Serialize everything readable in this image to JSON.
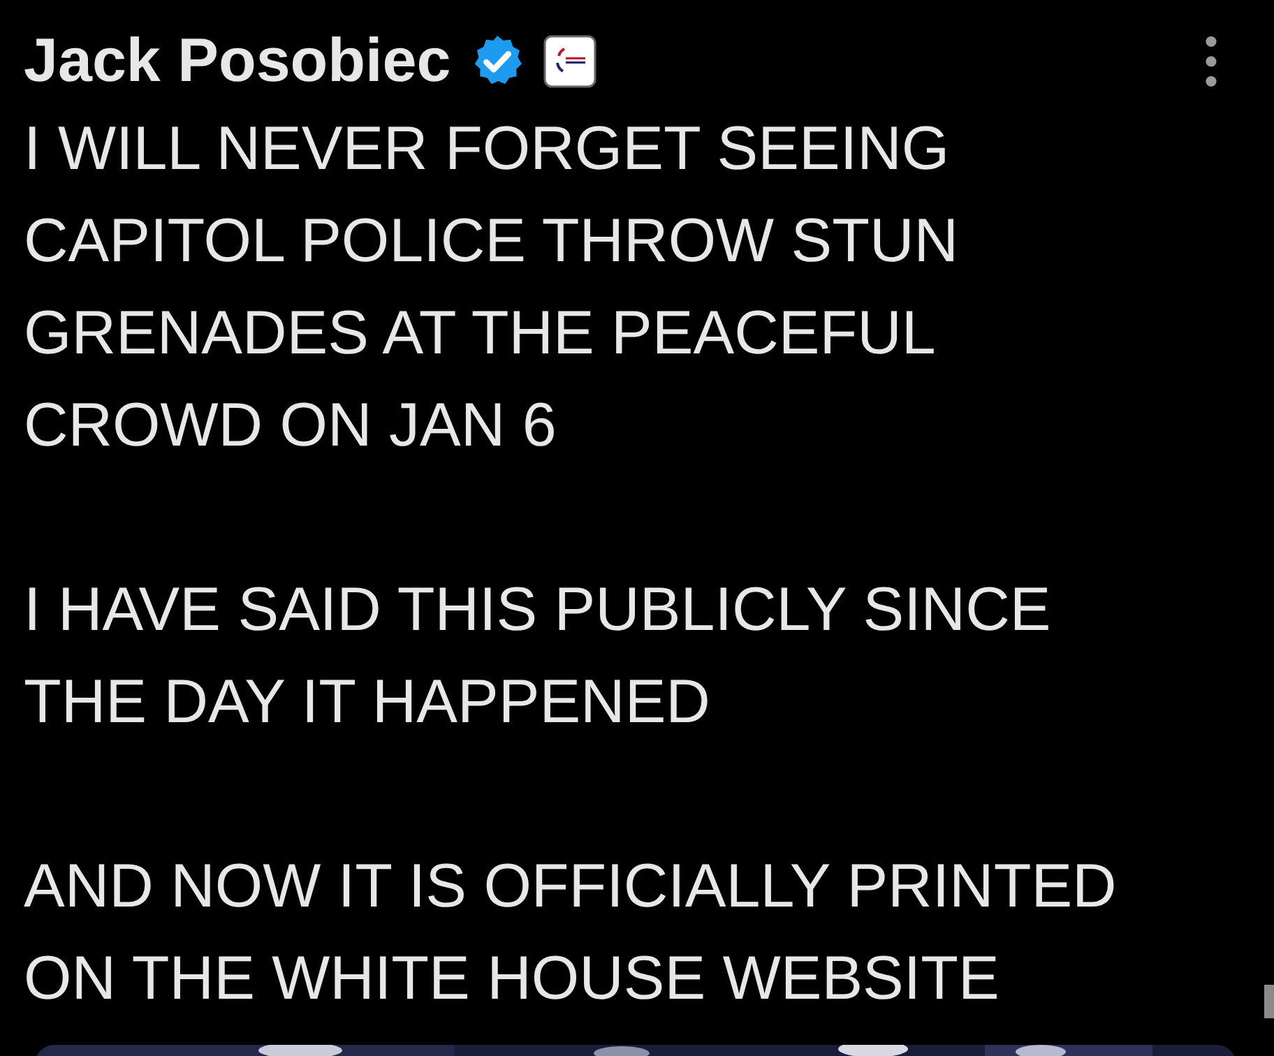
{
  "post": {
    "author": "Jack Posobiec",
    "verified": true,
    "paragraphs": [
      "I WILL NEVER FORGET SEEING CAPITOL POLICE THROW STUN GRENADES AT THE PEACEFUL CROWD ON JAN 6",
      "I HAVE SAID THIS PUBLICLY SINCE THE DAY IT HAPPENED",
      "AND NOW IT IS OFFICIALLY PRINTED ON THE WHITE HOUSE WEBSITE"
    ]
  }
}
